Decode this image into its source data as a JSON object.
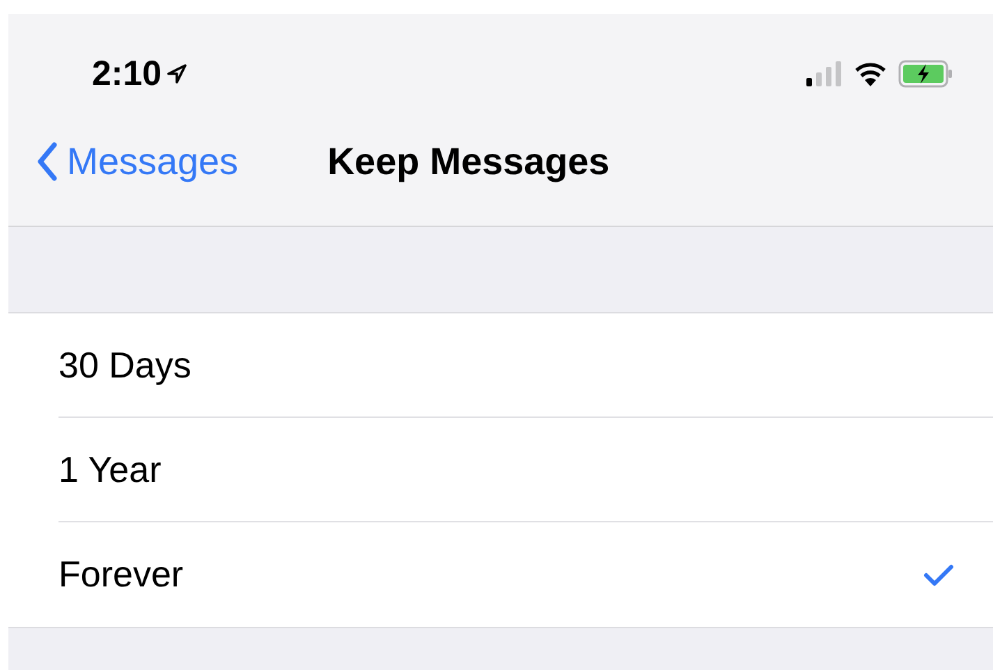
{
  "status_bar": {
    "time": "2:10"
  },
  "nav_bar": {
    "back_label": "Messages",
    "title": "Keep Messages"
  },
  "options": [
    {
      "label": "30 Days",
      "selected": false
    },
    {
      "label": "1 Year",
      "selected": false
    },
    {
      "label": "Forever",
      "selected": true
    }
  ]
}
